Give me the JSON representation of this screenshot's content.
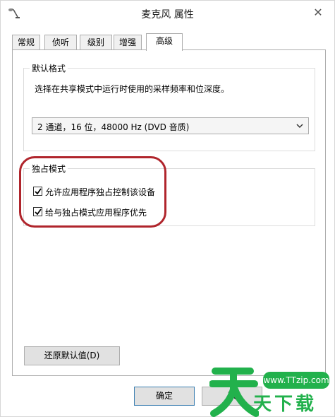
{
  "window": {
    "title": "麦克风 属性",
    "close_glyph": "✕"
  },
  "tabs": [
    {
      "label": "常规"
    },
    {
      "label": "侦听"
    },
    {
      "label": "级别"
    },
    {
      "label": "增强"
    },
    {
      "label": "高级"
    }
  ],
  "active_tab": "高级",
  "default_format": {
    "group_label": "默认格式",
    "description": "选择在共享模式中运行时使用的采样频率和位深度。",
    "selected_value": "2 通道，16 位，48000 Hz (DVD 音质)"
  },
  "exclusive_mode": {
    "group_label": "独占模式",
    "options": [
      {
        "label": "允许应用程序独占控制该设备",
        "checked": true
      },
      {
        "label": "给与独占模式应用程序优先",
        "checked": true
      }
    ]
  },
  "buttons": {
    "restore_defaults": "还原默认值(D)",
    "ok": "确定",
    "cancel": "取"
  },
  "watermark": {
    "url": "www.TTzip.com",
    "brand": "天下载"
  },
  "colors": {
    "highlight_oval": "#b0252c",
    "watermark_green": "#22b14c"
  }
}
